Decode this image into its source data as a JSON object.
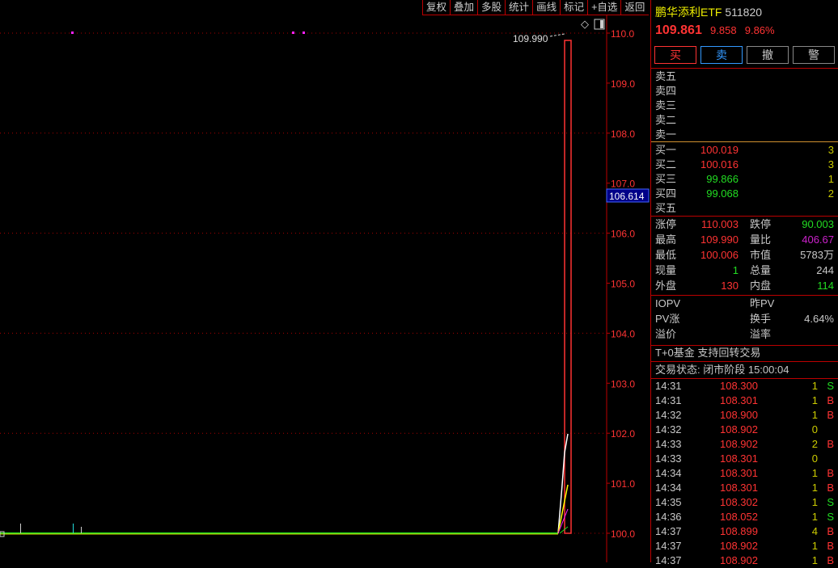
{
  "toolbar": [
    "复权",
    "叠加",
    "多股",
    "统计",
    "画线",
    "标记",
    "+自选",
    "返回"
  ],
  "chart": {
    "y_ticks": [
      "110.0",
      "109.0",
      "108.0",
      "107.0",
      "106.0",
      "105.0",
      "104.0",
      "103.0",
      "102.0",
      "101.0",
      "100.0"
    ],
    "high_label": "109.990",
    "cursor_price": "106.614"
  },
  "quote": {
    "name": "鹏华添利ETF",
    "code": "511820",
    "price": "109.861",
    "change": "9.858",
    "pct": "9.86%"
  },
  "buttons": {
    "buy": "买",
    "sell": "卖",
    "cancel": "撤",
    "alert": "警"
  },
  "asks": [
    {
      "label": "卖五"
    },
    {
      "label": "卖四"
    },
    {
      "label": "卖三"
    },
    {
      "label": "卖二"
    },
    {
      "label": "卖一"
    }
  ],
  "bids": [
    {
      "label": "买一",
      "price": "100.019",
      "vol": "3"
    },
    {
      "label": "买二",
      "price": "100.016",
      "vol": "3"
    },
    {
      "label": "买三",
      "price": "99.866",
      "vol": "1"
    },
    {
      "label": "买四",
      "price": "99.068",
      "vol": "2"
    },
    {
      "label": "买五",
      "price": "",
      "vol": ""
    }
  ],
  "stats": [
    {
      "l1": "涨停",
      "v1": "110.003",
      "l2": "跌停",
      "v2": "90.003"
    },
    {
      "l1": "最高",
      "v1": "109.990",
      "l2": "量比",
      "v2": "406.67"
    },
    {
      "l1": "最低",
      "v1": "100.006",
      "l2": "市值",
      "v2": "5783万"
    },
    {
      "l1": "现量",
      "v1": "1",
      "l2": "总量",
      "v2": "244"
    },
    {
      "l1": "外盘",
      "v1": "130",
      "l2": "内盘",
      "v2": "114"
    }
  ],
  "iopv": [
    {
      "l1": "IOPV",
      "l2": "昨PV",
      "v2": ""
    },
    {
      "l1": "PV涨",
      "l2": "换手",
      "v2": "4.64%"
    },
    {
      "l1": "溢价",
      "l2": "溢率",
      "v2": ""
    }
  ],
  "t0": "T+0基金 支持回转交易",
  "status": "交易状态: 闭市阶段 15:00:04",
  "trades": [
    {
      "t": "14:31",
      "p": "108.300",
      "v": "1",
      "s": "S"
    },
    {
      "t": "14:31",
      "p": "108.301",
      "v": "1",
      "s": "B"
    },
    {
      "t": "14:32",
      "p": "108.900",
      "v": "1",
      "s": "B"
    },
    {
      "t": "14:32",
      "p": "108.902",
      "v": "0",
      "s": ""
    },
    {
      "t": "14:33",
      "p": "108.902",
      "v": "2",
      "s": "B"
    },
    {
      "t": "14:33",
      "p": "108.301",
      "v": "0",
      "s": ""
    },
    {
      "t": "14:34",
      "p": "108.301",
      "v": "1",
      "s": "B"
    },
    {
      "t": "14:34",
      "p": "108.301",
      "v": "1",
      "s": "B"
    },
    {
      "t": "14:35",
      "p": "108.302",
      "v": "1",
      "s": "S"
    },
    {
      "t": "14:36",
      "p": "108.052",
      "v": "1",
      "s": "S"
    },
    {
      "t": "14:37",
      "p": "108.899",
      "v": "4",
      "s": "B"
    },
    {
      "t": "14:37",
      "p": "108.902",
      "v": "1",
      "s": "B"
    },
    {
      "t": "14:37",
      "p": "108.902",
      "v": "1",
      "s": "B"
    }
  ]
}
